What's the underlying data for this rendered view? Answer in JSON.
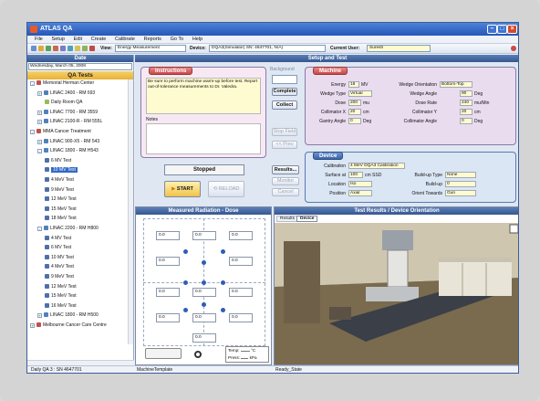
{
  "window": {
    "title": "ATLAS QA"
  },
  "menu": [
    "File",
    "Setup",
    "Edit",
    "Create",
    "Calibrate",
    "Reports",
    "Go To",
    "Help"
  ],
  "toolbar": {
    "view_label": "View:",
    "view_value": "Energy Measurement",
    "device_label": "Device:",
    "device_value": "DQA3(Simulator) SN: 4647701, N/A)",
    "user_label": "Current User:",
    "user_value": "Suresh"
  },
  "left": {
    "date_header": "Date",
    "date_value": "Wednesday,   March   05, 2008",
    "qa_header": "QA Tests",
    "tree": [
      {
        "label": "Memorial Herman Center",
        "level": 0,
        "exp": "-",
        "icon": "site"
      },
      {
        "label": "LINAC 2400 - RM 693",
        "level": 1,
        "exp": "+",
        "icon": "linac"
      },
      {
        "label": "Daily Room QA",
        "level": 2,
        "exp": "",
        "icon": "qa"
      },
      {
        "label": "LINAC 7700 - RM 3559",
        "level": 1,
        "exp": "+",
        "icon": "linac"
      },
      {
        "label": "LINAC 2100-R - RM 555L",
        "level": 1,
        "exp": "+",
        "icon": "linac"
      },
      {
        "label": "MMA Cancer Treatment",
        "level": 0,
        "exp": "-",
        "icon": "site"
      },
      {
        "label": "LINAC 900-X5 - RM 543",
        "level": 1,
        "exp": "+",
        "icon": "linac"
      },
      {
        "label": "LINAC 1800 - RM H543",
        "level": 1,
        "exp": "-",
        "icon": "linac"
      },
      {
        "label": "6 MV Test",
        "level": 2,
        "exp": "",
        "icon": "test"
      },
      {
        "label": "10 MV Test",
        "level": 2,
        "exp": "",
        "icon": "test",
        "selected": true
      },
      {
        "label": "4 MeV Test",
        "level": 2,
        "exp": "",
        "icon": "test"
      },
      {
        "label": "9 MeV Test",
        "level": 2,
        "exp": "",
        "icon": "test"
      },
      {
        "label": "12 MeV Test",
        "level": 2,
        "exp": "",
        "icon": "test"
      },
      {
        "label": "15 MeV Test",
        "level": 2,
        "exp": "",
        "icon": "test"
      },
      {
        "label": "18 MeV Test",
        "level": 2,
        "exp": "",
        "icon": "test"
      },
      {
        "label": "LINAC 2200 - RM H800",
        "level": 1,
        "exp": "-",
        "icon": "linac"
      },
      {
        "label": "4 MV Test",
        "level": 2,
        "exp": "",
        "icon": "test"
      },
      {
        "label": "6 MV Test",
        "level": 2,
        "exp": "",
        "icon": "test"
      },
      {
        "label": "10 MV Test",
        "level": 2,
        "exp": "",
        "icon": "test"
      },
      {
        "label": "4 MeV Test",
        "level": 2,
        "exp": "",
        "icon": "test"
      },
      {
        "label": "9 MeV Test",
        "level": 2,
        "exp": "",
        "icon": "test"
      },
      {
        "label": "12 MeV Test",
        "level": 2,
        "exp": "",
        "icon": "test"
      },
      {
        "label": "15 MeV Test",
        "level": 2,
        "exp": "",
        "icon": "test"
      },
      {
        "label": "16 MeV Test",
        "level": 2,
        "exp": "",
        "icon": "test"
      },
      {
        "label": "LINAC 1800 - RM H500",
        "level": 1,
        "exp": "+",
        "icon": "linac"
      },
      {
        "label": "Melbourne Cancer Care Centre",
        "level": 0,
        "exp": "+",
        "icon": "site"
      }
    ]
  },
  "setup": {
    "header": "Setup and Test",
    "instructions_title": "Instructions",
    "instructions_text": "Be sure to perform machine warm-up before test. Report out-of-tolerance measurements to Dr. Valedra.",
    "notes_label": "Notes",
    "background_label": "Background",
    "complete_label": "Complete",
    "collect_label": "Collect",
    "stop_field_label": "Stop Field",
    "prev_label": "<< Prev",
    "status_value": "Stopped",
    "start_label": "START",
    "reload_label": "RELOAD",
    "results_label": "Results...",
    "monitor_label": "Monitor",
    "cancel_label": "Cancel"
  },
  "machine": {
    "title": "Machine",
    "energy_label": "Energy",
    "energy_value": "18",
    "energy_unit": "MV",
    "wedge_type_label": "Wedge Type",
    "wedge_type_value": "Virtual",
    "dose_label": "Dose",
    "dose_value": "200",
    "dose_unit": "mu",
    "collx_label": "Collimator X",
    "collx_value": "20",
    "collx_unit": "cm",
    "gantry_label": "Gantry Angle",
    "gantry_value": "0",
    "gantry_unit": "Deg",
    "wedge_orient_label": "Wedge Orientation",
    "wedge_orient_value": "Bottom-Top",
    "wedge_angle_label": "Wedge Angle",
    "wedge_angle_value": "90",
    "wedge_angle_unit": "Deg",
    "dose_rate_label": "Dose Rate",
    "dose_rate_value": "240",
    "dose_rate_unit": "mu/Min",
    "colly_label": "Collimator Y",
    "colly_value": "20",
    "colly_unit": "cm",
    "coll_angle_label": "Collimator Angle",
    "coll_angle_value": "0",
    "coll_angle_unit": "Deg"
  },
  "device": {
    "title": "Device",
    "calibration_label": "Calibration",
    "calibration_value": "4 MeV DQA3 Calibration",
    "surface_label": "Surface at",
    "surface_value": "100",
    "surface_unit": "cm SSD",
    "location_label": "Location",
    "location_value": "Iso",
    "position_label": "Position",
    "position_value": "Axial",
    "buildup_type_label": "Build-up Type",
    "buildup_type_value": "None",
    "buildup_label": "Build-up",
    "buildup_value": "0",
    "orient_label": "Orient Towards",
    "orient_value": "Gun"
  },
  "measured": {
    "title": "Measured Radiation - Dose",
    "cells": [
      "0.0",
      "0.0",
      "0.0",
      "0.0",
      "0.0",
      "0.0",
      "0.0",
      "0.0",
      "0.0",
      "0.0",
      "0.0",
      "0.0"
    ],
    "temp_label": "Temp:",
    "temp_unit": "°C",
    "press_label": "Press:",
    "press_unit": "kPa"
  },
  "results": {
    "title": "Test Results / Device Orientation",
    "tab_results": "Results",
    "tab_device": "Device"
  },
  "statusbar": {
    "left": "Daily QA 3 : SN 4647701",
    "mid": "MachineTemplate",
    "right": "Ready_State"
  }
}
